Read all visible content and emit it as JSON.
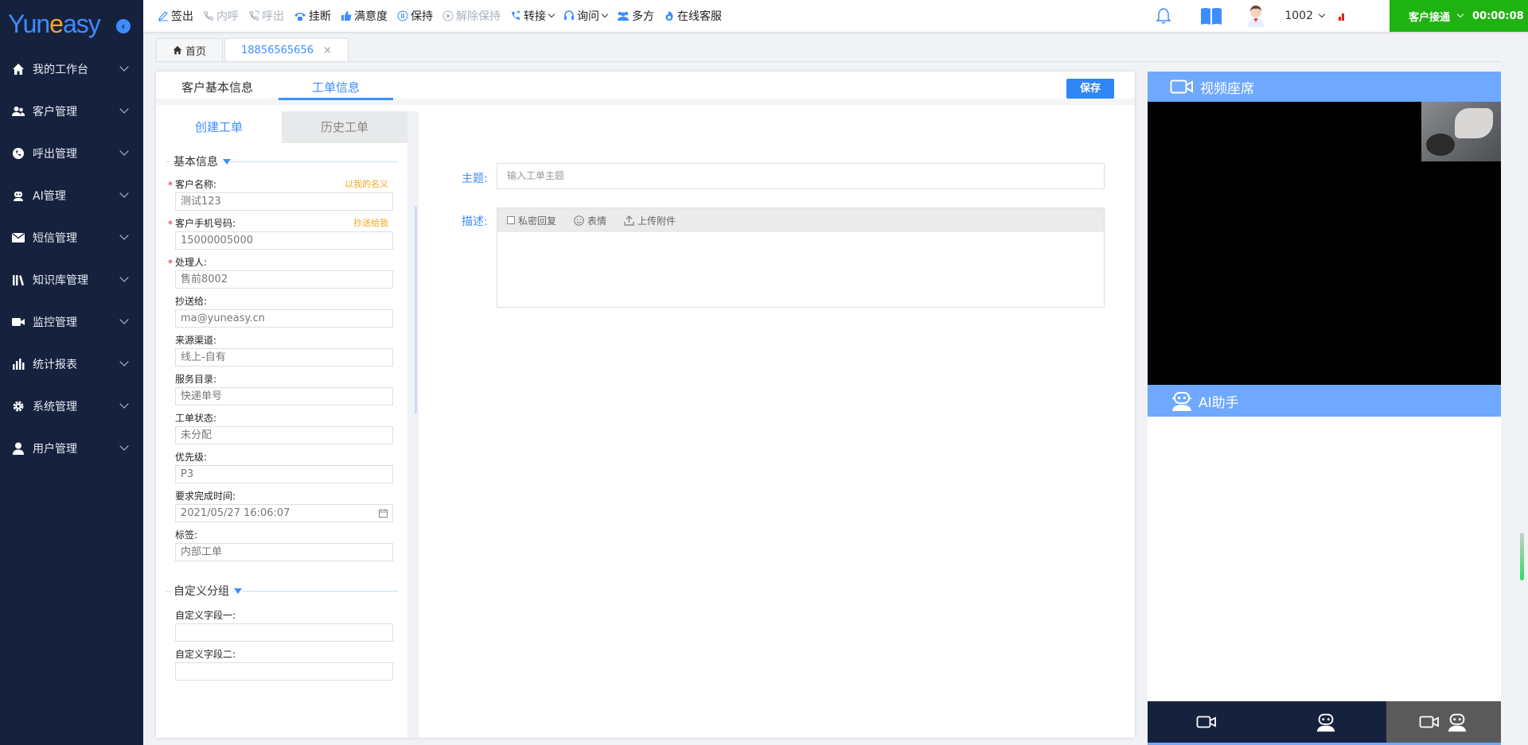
{
  "logo": {
    "text_a": "Yun",
    "text_b": "e",
    "text_c": "asy"
  },
  "sidebar": {
    "items": [
      {
        "label": "我的工作台",
        "icon": "home-icon"
      },
      {
        "label": "客户管理",
        "icon": "users-icon"
      },
      {
        "label": "呼出管理",
        "icon": "phone-out-icon"
      },
      {
        "label": "AI管理",
        "icon": "robot-icon"
      },
      {
        "label": "短信管理",
        "icon": "mail-icon"
      },
      {
        "label": "知识库管理",
        "icon": "books-icon"
      },
      {
        "label": "监控管理",
        "icon": "camera-icon"
      },
      {
        "label": "统计报表",
        "icon": "bar-chart-icon"
      },
      {
        "label": "系统管理",
        "icon": "gear-icon"
      },
      {
        "label": "用户管理",
        "icon": "user-icon"
      }
    ]
  },
  "toolbar": {
    "signout": "签出",
    "inbound": "内呼",
    "outbound": "呼出",
    "hangup": "挂断",
    "satisfaction": "满意度",
    "hold": "保持",
    "unhold": "解除保持",
    "transfer": "转接",
    "consult": "询问",
    "conference": "多方",
    "online": "在线客服"
  },
  "header": {
    "extension": "1002",
    "status": "客户接通",
    "timer": "00:00:08"
  },
  "pagetabs": {
    "home": "首页",
    "phone": "18856565656",
    "close": "×"
  },
  "card": {
    "tab_basic": "客户基本信息",
    "tab_ticket": "工单信息",
    "save": "保存",
    "sub_create": "创建工单",
    "sub_history": "历史工单",
    "group_basic": "基本信息",
    "group_custom": "自定义分组"
  },
  "fields": {
    "customer_name_label": "客户名称:",
    "customer_name_link": "以我的名义",
    "customer_name_value": "测试123",
    "phone_label": "客户手机号码:",
    "phone_link": "抄送给我",
    "phone_value": "15000005000",
    "handler_label": "处理人:",
    "handler_value": "售前8002",
    "cc_label": "抄送给:",
    "cc_value": "ma@yuneasy.cn",
    "source_label": "来源渠道:",
    "source_value": "线上-自有",
    "catalog_label": "服务目录:",
    "catalog_value": "快递单号",
    "status_label": "工单状态:",
    "status_value": "未分配",
    "priority_label": "优先级:",
    "priority_value": "P3",
    "deadline_label": "要求完成时间:",
    "deadline_value": "2021/05/27  16:06:07",
    "tags_label": "标签:",
    "tags_value": "内部工单",
    "custom1_label": "自定义字段一:",
    "custom1_value": "",
    "custom2_label": "自定义字段二:",
    "custom2_value": ""
  },
  "form": {
    "subject_label": "主题:",
    "subject_placeholder": "输入工单主题",
    "desc_label": "描述:",
    "private_reply": "私密回复",
    "emoji": "表情",
    "upload": "上传附件"
  },
  "vpanel": {
    "video_title": "视频座席",
    "ai_title": "AI助手"
  },
  "colors": {
    "sidebar": "#16213e",
    "accent": "#3d8dff",
    "status_green": "#1fb311",
    "panel_blue": "#6ea8ff"
  }
}
